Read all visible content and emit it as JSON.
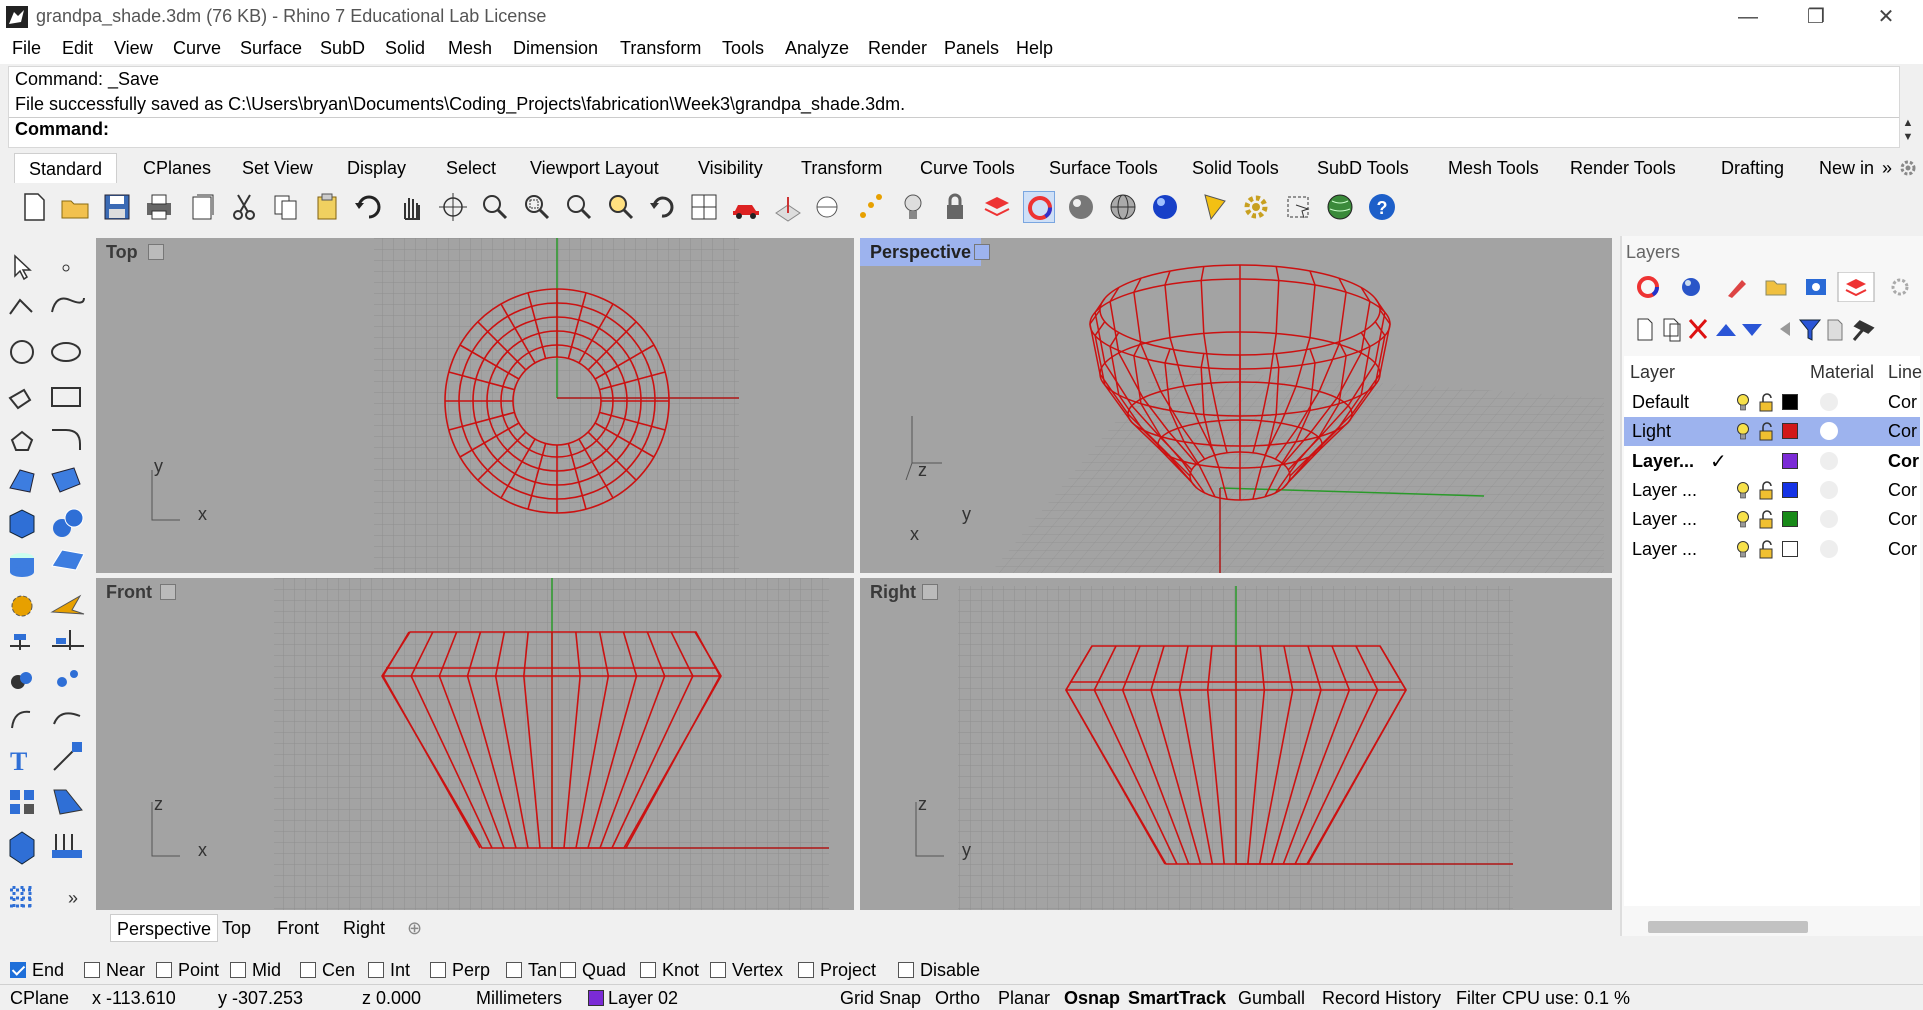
{
  "window": {
    "title": "grandpa_shade.3dm (76 KB) - Rhino 7 Educational Lab License",
    "minimize": "—",
    "restore": "❐",
    "close": "✕"
  },
  "menu": [
    "File",
    "Edit",
    "View",
    "Curve",
    "Surface",
    "SubD",
    "Solid",
    "Mesh",
    "Dimension",
    "Transform",
    "Tools",
    "Analyze",
    "Render",
    "Panels",
    "Help"
  ],
  "command": {
    "history": [
      "Command: _Save",
      "File successfully saved as C:\\Users\\bryan\\Documents\\Coding_Projects\\fabrication\\Week3\\grandpa_shade.3dm."
    ],
    "prompt": "Command:"
  },
  "tabs": [
    "Standard",
    "CPlanes",
    "Set View",
    "Display",
    "Select",
    "Viewport Layout",
    "Visibility",
    "Transform",
    "Curve Tools",
    "Surface Tools",
    "Solid Tools",
    "SubD Tools",
    "Mesh Tools",
    "Render Tools",
    "Drafting",
    "New in"
  ],
  "tabs_overflow": "»",
  "viewports": {
    "top": {
      "label": "Top",
      "axis_v": "y",
      "axis_h": "x"
    },
    "perspective": {
      "label": "Perspective",
      "axis_v": "z",
      "axis_h": "y",
      "axis_d": "x"
    },
    "front": {
      "label": "Front",
      "axis_v": "z",
      "axis_h": "x"
    },
    "right": {
      "label": "Right",
      "axis_v": "z",
      "axis_h": "y"
    }
  },
  "viewport_tabs": [
    "Perspective",
    "Top",
    "Front",
    "Right"
  ],
  "viewport_tabs_add": "⊕",
  "osnaps": [
    {
      "label": "End",
      "checked": true
    },
    {
      "label": "Near",
      "checked": false
    },
    {
      "label": "Point",
      "checked": false
    },
    {
      "label": "Mid",
      "checked": false
    },
    {
      "label": "Cen",
      "checked": false
    },
    {
      "label": "Int",
      "checked": false
    },
    {
      "label": "Perp",
      "checked": false
    },
    {
      "label": "Tan",
      "checked": false
    },
    {
      "label": "Quad",
      "checked": false
    },
    {
      "label": "Knot",
      "checked": false
    },
    {
      "label": "Vertex",
      "checked": false
    },
    {
      "label": "Project",
      "checked": false
    },
    {
      "label": "Disable",
      "checked": false
    }
  ],
  "status": {
    "cplane": "CPlane",
    "x": "x -113.610",
    "y": "y -307.253",
    "z": "z 0.000",
    "units": "Millimeters",
    "layer": "Layer 02",
    "layer_color": "#7b2bd6",
    "grid_snap": "Grid Snap",
    "ortho": "Ortho",
    "planar": "Planar",
    "osnap": "Osnap",
    "smarttrack": "SmartTrack",
    "gumball": "Gumball",
    "record_history": "Record History",
    "filter": "Filter",
    "cpu": "CPU use: 0.1 %"
  },
  "layers_panel": {
    "title": "Layers",
    "col_layer": "Layer",
    "col_material": "Material",
    "col_line": "Line",
    "rows": [
      {
        "name": "Default",
        "color": "#000000",
        "line": "Cor",
        "selected": false,
        "current": false
      },
      {
        "name": "Light",
        "color": "#d11919",
        "line": "Cor",
        "selected": true,
        "current": false
      },
      {
        "name": "Layer...",
        "color": "#7b2bd6",
        "line": "Cor",
        "selected": false,
        "current": true,
        "check": "✓"
      },
      {
        "name": "Layer ...",
        "color": "#1533e6",
        "line": "Cor",
        "selected": false,
        "current": false
      },
      {
        "name": "Layer ...",
        "color": "#188a18",
        "line": "Cor",
        "selected": false,
        "current": false
      },
      {
        "name": "Layer ...",
        "color": "#ffffff",
        "line": "Cor",
        "selected": false,
        "current": false
      }
    ]
  },
  "colors": {
    "wire": "#cc1111",
    "viewport_bg": "#a3a3a3",
    "active_label": "#9db3ee",
    "selection": "#9db3ee"
  }
}
